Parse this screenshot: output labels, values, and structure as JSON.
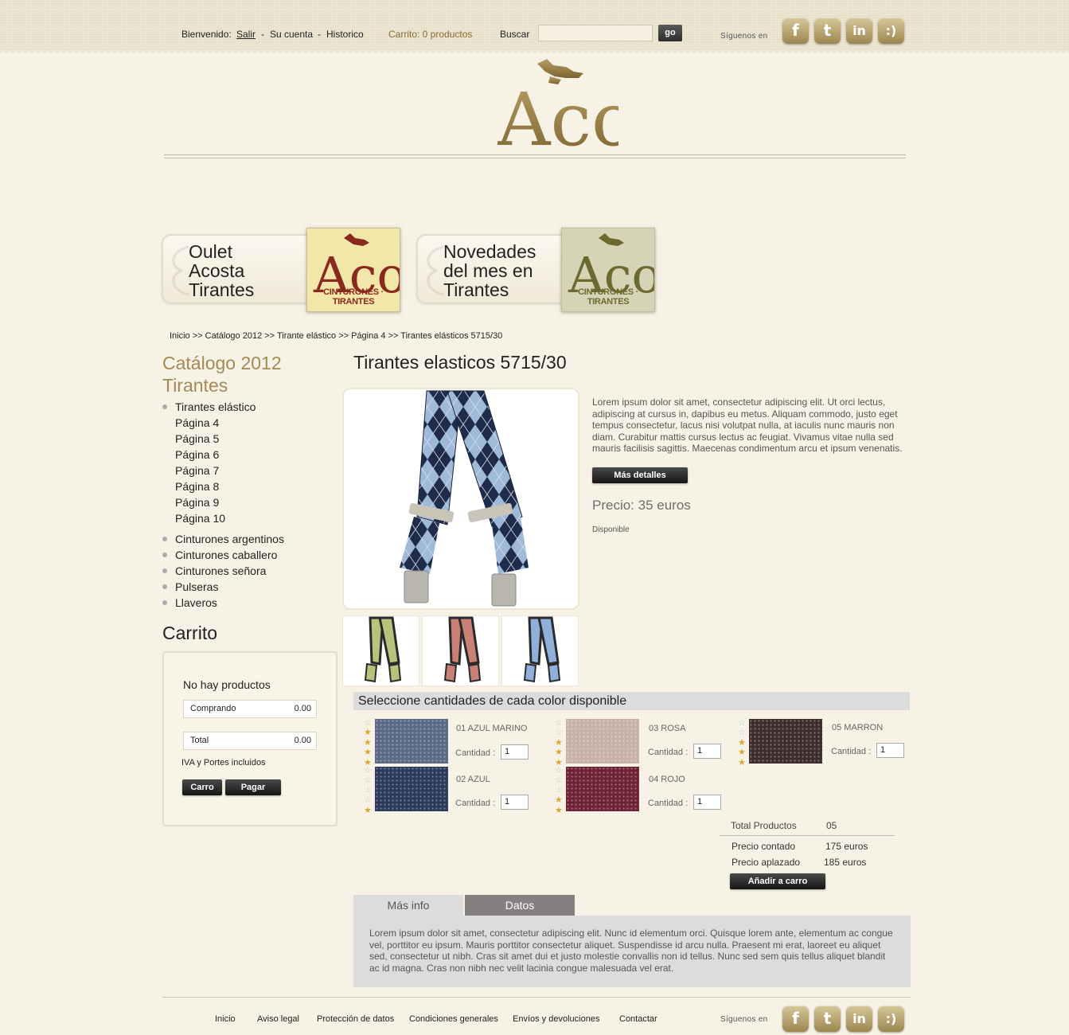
{
  "topbar": {
    "welcome": "Bienvenido:",
    "logout": "Salir",
    "sep1": "-",
    "account": "Su cuenta",
    "sep2": "-",
    "history": "Historico",
    "cart_status": "Carrito: 0 productos",
    "search_label": "Buscar",
    "search_value": "",
    "go_label": "go",
    "follow_label": "Síguenos en",
    "social": [
      {
        "icon": "facebook-icon",
        "glyph": "f"
      },
      {
        "icon": "twitter-icon",
        "glyph": "t"
      },
      {
        "icon": "linkedin-icon",
        "glyph": "in"
      },
      {
        "icon": "tuenti-icon",
        "glyph": ":)"
      }
    ]
  },
  "logo": {
    "text": "AcostA"
  },
  "banners": [
    {
      "label": "Oulet Acosta Tirantes",
      "lines": [
        "Oulet",
        "Acosta",
        "Tirantes"
      ],
      "brand": "CINTURONES · TIRANTES",
      "color": "#f2e6a8",
      "logo_color": "#8a2a1e"
    },
    {
      "label": "Novedades del mes en Tirantes",
      "lines": [
        "Novedades",
        "del mes en",
        "Tirantes"
      ],
      "brand": "CINTURONES · TIRANTES",
      "color": "#d6d4b6",
      "logo_color": "#6c6a30"
    }
  ],
  "breadcrumb": "Inicio >> Catálogo 2012 >> Tirante elástico >> Página 4 >> Tirantes elásticos 5715/30",
  "sidebar": {
    "title_line1": "Catálogo 2012",
    "title_line2": "Tirantes",
    "categories": [
      {
        "label": "Tirantes elástico",
        "sub": [
          "Página 4",
          "Página 5",
          "Página 6",
          "Página 7",
          "Página 8",
          "Página 9",
          "Página 10"
        ]
      },
      {
        "label": "Cinturones argentinos",
        "sub": []
      },
      {
        "label": "Cinturones caballero",
        "sub": []
      },
      {
        "label": "Cinturones señora",
        "sub": []
      },
      {
        "label": "Pulseras",
        "sub": []
      },
      {
        "label": "Llaveros",
        "sub": []
      }
    ]
  },
  "cart": {
    "title": "Carrito",
    "empty": "No hay productos",
    "buying_label": "Comprando",
    "buying_value": "0.00",
    "total_label": "Total",
    "total_value": "0.00",
    "iva": "IVA y Portes incluidos",
    "carro_button": "Carro",
    "pay_button": "Pagar"
  },
  "product": {
    "title": "Tirantes elasticos 5715/30",
    "description": "Lorem ipsum dolor sit amet, consectetur adipiscing elit. Ut orci lectus, adipiscing at cursus in, dapibus eu metus. Aliquam commodo, justo eget tempus consectetur, lacus nisi volutpat nulla, at iaculis nunc mauris non diam. Curabitur mattis cursus lectus ac feugiat. Vivamus vitae nulla sed mauris facilisis sagittis. Maecenas condimentum arcu et ipsum venenatis.",
    "details_button": "Más detalles",
    "price": "Precio: 35 euros",
    "availability": "Disponible",
    "thumbnails": [
      {
        "name": "thumb-green",
        "color": "#b8c27a"
      },
      {
        "name": "thumb-red",
        "color": "#c98077"
      },
      {
        "name": "thumb-blue",
        "color": "#8fb0d8"
      }
    ]
  },
  "colors": {
    "heading": "Seleccione cantidades de cada color disponible",
    "qty_label": "Cantidad :",
    "items": [
      {
        "code": "01 AZUL MARINO",
        "qty": "1",
        "swatch": "#5a6a86",
        "stars_on": 4
      },
      {
        "code": "02 AZUL",
        "qty": "1",
        "swatch": "#2c3b5d",
        "stars_on": 1
      },
      {
        "code": "03 ROSA",
        "qty": "1",
        "swatch": "#c8b1a8",
        "stars_on": 3
      },
      {
        "code": "04 ROJO",
        "qty": "1",
        "swatch": "#6e2236",
        "stars_on": 2
      },
      {
        "code": "05 MARRON",
        "qty": "1",
        "swatch": "#3e2c2e",
        "stars_on": 3
      }
    ]
  },
  "totals": {
    "products_label": "Total Productos",
    "products_value": "05",
    "cash_label": "Precio contado",
    "cash_value": "175 euros",
    "deferred_label": "Precio aplazado",
    "deferred_value": "185 euros",
    "add_button": "Añadir a carro"
  },
  "tabs": {
    "items": [
      "Más info",
      "Datos"
    ],
    "body": "Lorem ipsum dolor sit amet, consectetur adipiscing elit. Nunc id elementum orci. Quisque lorem ante, elementum ac congue vel, porttitor eu ipsum. Mauris porttitor consectetur aliquet. Suspendisse id arcu nulla. Praesent mi erat, laoreet eu aliquet sed, consectetur ut nibh. Cras sit amet dui et justo molestie convallis non id tellus. Nunc sed sem quis tellus aliquet blandit ac id magna. Cras non nibh nec velit lacinia congue malesuada vel erat."
  },
  "footer": {
    "links": [
      "Inicio",
      "Aviso legal",
      "Protección de datos",
      "Condiciones generales",
      "Envíos y devoluciones",
      "Contactar"
    ],
    "follow_label": "Síguenos en"
  }
}
